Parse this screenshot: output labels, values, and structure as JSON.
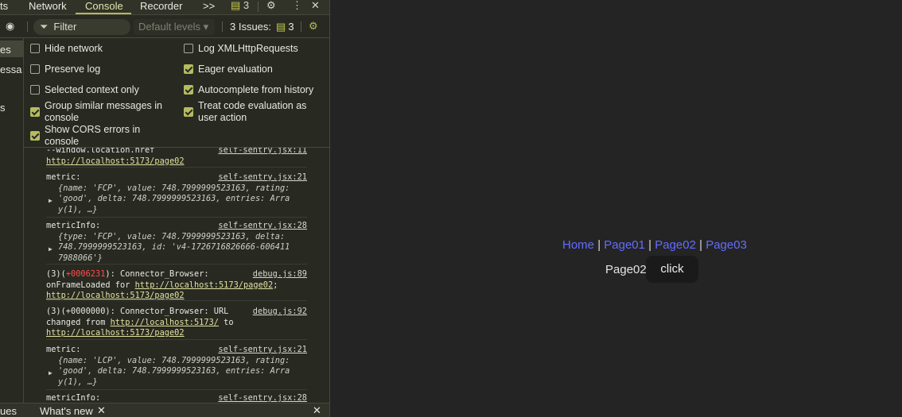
{
  "devtools": {
    "tabs": {
      "partial": "ts",
      "network": "Network",
      "console": "Console",
      "recorder": "Recorder",
      "more": ">>",
      "issues_count": "3"
    },
    "filter_placeholder": "Filter",
    "levels": "Default levels ▾",
    "issues_label": "3 Issues:",
    "issues_count": "3",
    "sidebar": [
      "es",
      "essa…",
      "s"
    ],
    "settings": [
      {
        "label": "Hide network",
        "checked": false
      },
      {
        "label": "Preserve log",
        "checked": false
      },
      {
        "label": "Selected context only",
        "checked": false
      },
      {
        "label": "Group similar messages in console",
        "checked": true
      },
      {
        "label": "Show CORS errors in console",
        "checked": true
      },
      {
        "label": "Log XMLHttpRequests",
        "checked": false
      },
      {
        "label": "Eager evaluation",
        "checked": true
      },
      {
        "label": "Autocomplete from history",
        "checked": true
      },
      {
        "label": "Treat code evaluation as user action",
        "checked": true
      }
    ],
    "log": {
      "m0": {
        "text": "--window.location.href",
        "src": "self-sentry.jsx:11",
        "link": "http://localhost:5173/page02"
      },
      "m1": {
        "label": "metric:",
        "src": "self-sentry.jsx:21",
        "l1": "{name: 'FCP', value: 748.7999999523163, rating:",
        "l2": "'good', delta: 748.7999999523163, entries: Arra",
        "l3": "y(1), …}"
      },
      "m2": {
        "label": "metricInfo:",
        "src": "self-sentry.jsx:28",
        "l1": "{type: 'FCP', value: 748.7999999523163, delta:",
        "l2": "748.7999999523163, id: 'v4-1726716826666-606411",
        "l3": "7988066'}"
      },
      "m3": {
        "prefix": "(3)(",
        "red": "+0006231",
        "after": "): Connector_Browser:",
        "src": "debug.js:89",
        "l2": "onFrameLoaded for ",
        "link1": "http://localhost:5173/page02",
        "semi": ";",
        "link2": "http://localhost:5173/page02"
      },
      "m4": {
        "l1": "(3)(+0000000): Connector_Browser: URL",
        "src": "debug.js:92",
        "l2": "changed from ",
        "link1": "http://localhost:5173/",
        "to": " to",
        "link2": "http://localhost:5173/page02"
      },
      "m5": {
        "label": "metric:",
        "src": "self-sentry.jsx:21",
        "l1": "{name: 'LCP', value: 748.7999999523163, rating:",
        "l2": "'good', delta: 748.7999999523163, entries: Arra",
        "l3": "y(1), …}"
      },
      "m6": {
        "label": "metricInfo:",
        "src": "self-sentry.jsx:28"
      }
    },
    "drawer": {
      "partial": "ues",
      "whats_new": "What's new"
    }
  },
  "page": {
    "nav": [
      "Home",
      "Page01",
      "Page02",
      "Page03"
    ],
    "separator": "|",
    "page_name": "Page02",
    "button": "click"
  },
  "colors": {
    "link": "#646cff",
    "accent": "#b5bc60",
    "error": "#ff4d4d"
  }
}
